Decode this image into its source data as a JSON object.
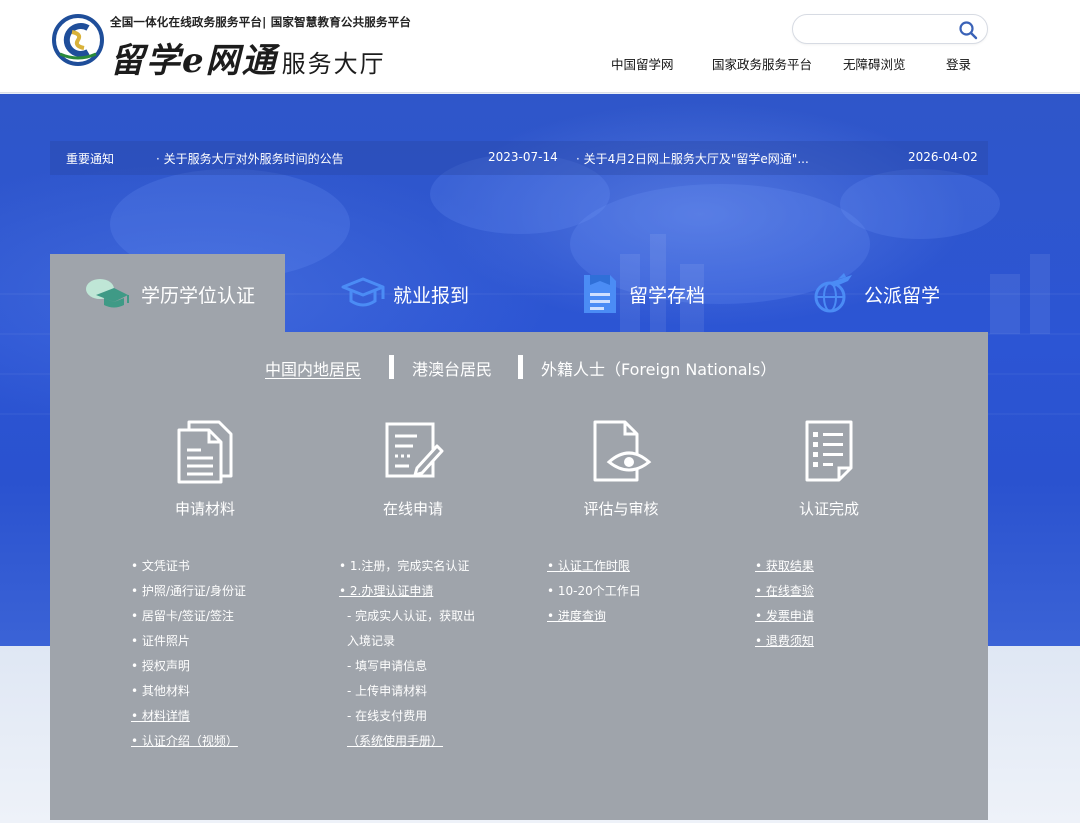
{
  "header": {
    "subtitle": "全国一体化在线政务服务平台| 国家智慧教育公共服务平台",
    "brand": "留学e网通",
    "hall": "服务大厅",
    "search_placeholder": "",
    "nav": [
      "中国留学网",
      "国家政务服务平台",
      "无障碍浏览",
      "登录"
    ]
  },
  "notice": {
    "label": "重要通知",
    "items": [
      {
        "title": "· 关于服务大厅对外服务时间的公告",
        "date": "2023-07-14"
      },
      {
        "title": "· 关于4月2日网上服务大厅及\"留学e网通\"...",
        "date": "2026-04-02"
      }
    ]
  },
  "tabs": [
    "学历学位认证",
    "就业报到",
    "留学存档",
    "公派留学"
  ],
  "active_tab": 0,
  "regions": [
    "中国内地居民",
    "港澳台居民",
    "外籍人士（Foreign Nationals）"
  ],
  "active_region": 0,
  "steps": [
    {
      "label": "申请材料",
      "icon": "documents-icon",
      "items": [
        {
          "text": "• 文凭证书",
          "link": false
        },
        {
          "text": "• 护照/通行证/身份证",
          "link": false
        },
        {
          "text": "• 居留卡/签证/签注",
          "link": false
        },
        {
          "text": "• 证件照片",
          "link": false
        },
        {
          "text": "• 授权声明",
          "link": false
        },
        {
          "text": "• 其他材料",
          "link": false
        },
        {
          "text": "• 材料详情",
          "link": true
        },
        {
          "text": "• 认证介绍（视频）",
          "link": true
        }
      ]
    },
    {
      "label": "在线申请",
      "icon": "form-edit-icon",
      "items": [
        {
          "text": "• 1.注册，完成实名认证",
          "link": false
        },
        {
          "text": "• 2.办理认证申请",
          "link": true
        },
        {
          "text": "- 完成实人认证，获取出",
          "link": false
        },
        {
          "text": "入境记录",
          "link": false
        },
        {
          "text": "- 填写申请信息",
          "link": false
        },
        {
          "text": "- 上传申请材料",
          "link": false
        },
        {
          "text": "- 在线支付费用",
          "link": false
        },
        {
          "text": "（系统使用手册）",
          "link": true
        }
      ]
    },
    {
      "label": "评估与审核",
      "icon": "document-eye-icon",
      "items": [
        {
          "text": "• 认证工作时限",
          "link": true
        },
        {
          "text": "• 10-20个工作日",
          "link": false
        },
        {
          "text": "• 进度查询",
          "link": true
        }
      ]
    },
    {
      "label": "认证完成",
      "icon": "checklist-icon",
      "items": [
        {
          "text": "• 获取结果",
          "link": true
        },
        {
          "text": "• 在线查验",
          "link": true
        },
        {
          "text": "• 发票申请",
          "link": true
        },
        {
          "text": "• 退费须知",
          "link": true
        }
      ]
    }
  ],
  "colors": {
    "banner_blue": "#2c55d4",
    "panel_gray": "#9fa4ab",
    "icon_blue": "#4b8cf5",
    "search_blue": "#3a62b7"
  }
}
